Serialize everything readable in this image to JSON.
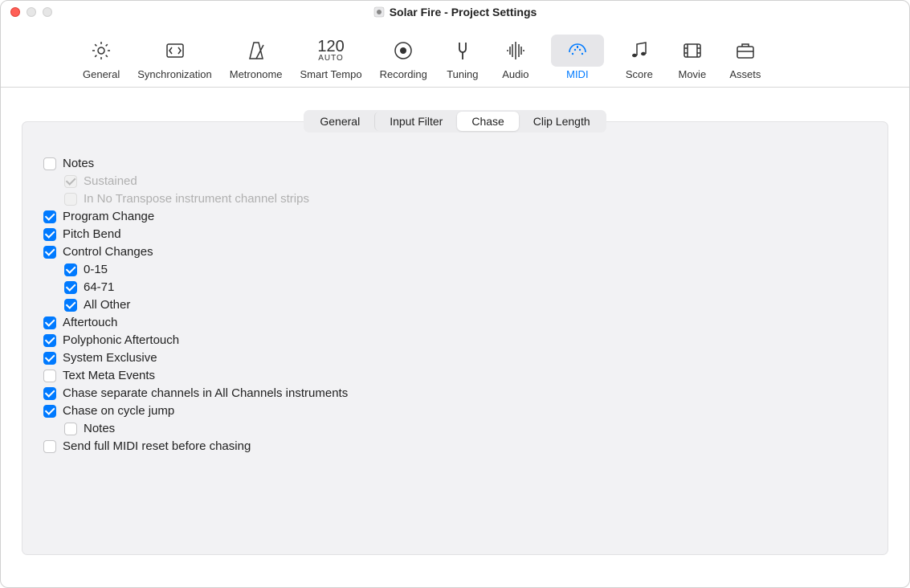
{
  "window": {
    "title": "Solar Fire - Project Settings"
  },
  "toolbar": {
    "items": [
      {
        "label": "General"
      },
      {
        "label": "Synchronization"
      },
      {
        "label": "Metronome"
      },
      {
        "label": "Smart Tempo",
        "bpm": "120",
        "auto": "AUTO"
      },
      {
        "label": "Recording"
      },
      {
        "label": "Tuning"
      },
      {
        "label": "Audio"
      },
      {
        "label": "MIDI"
      },
      {
        "label": "Score"
      },
      {
        "label": "Movie"
      },
      {
        "label": "Assets"
      }
    ]
  },
  "segments": {
    "items": [
      {
        "label": "General"
      },
      {
        "label": "Input Filter"
      },
      {
        "label": "Chase"
      },
      {
        "label": "Clip Length"
      }
    ]
  },
  "chase": {
    "notes": "Notes",
    "sustained": "Sustained",
    "in_no_transpose": "In No Transpose instrument channel strips",
    "program_change": "Program Change",
    "pitch_bend": "Pitch Bend",
    "control_changes": "Control Changes",
    "cc_0_15": "0-15",
    "cc_64_71": "64-71",
    "cc_all_other": "All Other",
    "aftertouch": "Aftertouch",
    "poly_aftertouch": "Polyphonic Aftertouch",
    "sysex": "System Exclusive",
    "text_meta": "Text Meta Events",
    "chase_separate": "Chase separate channels in All Channels instruments",
    "chase_cycle": "Chase on cycle jump",
    "cycle_notes": "Notes",
    "send_full_reset": "Send full MIDI reset before chasing"
  }
}
